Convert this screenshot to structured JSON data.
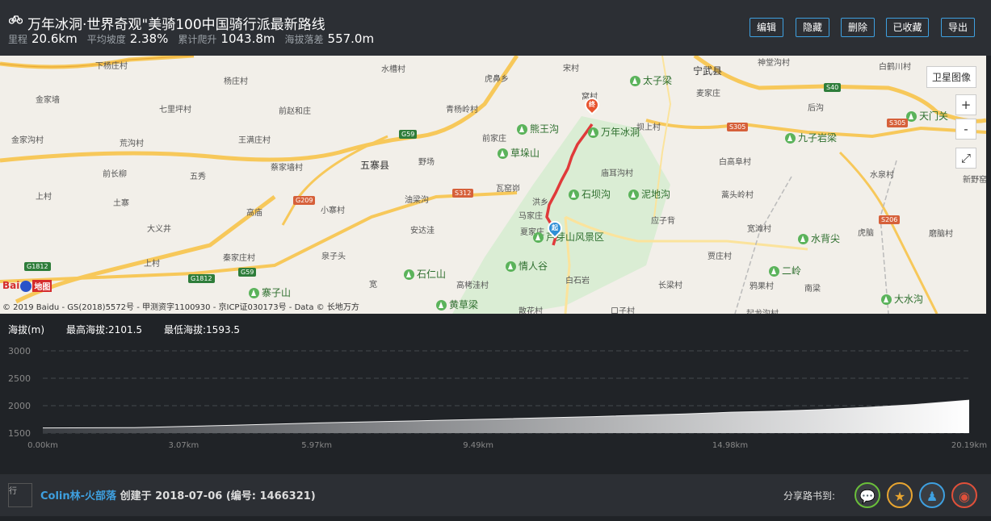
{
  "header": {
    "title": "万年冰洞·世界奇观\"美骑100中国骑行派最新路线",
    "stats": [
      {
        "label": "里程",
        "value": "20.6km"
      },
      {
        "label": "平均坡度",
        "value": "2.38%"
      },
      {
        "label": "累计爬升",
        "value": "1043.8m"
      },
      {
        "label": "海拔落差",
        "value": "557.0m"
      }
    ],
    "buttons": {
      "edit": "编辑",
      "hide": "隐藏",
      "delete": "删除",
      "collected": "已收藏",
      "export": "导出"
    }
  },
  "map": {
    "satellite_label": "卫星图像",
    "zoom_in": "+",
    "zoom_out": "-",
    "fullscreen": "⤢",
    "copyright": "© 2019 Baidu - GS(2018)5572号 - 甲测资字1100930 - 京ICP证030173号 - Data © 长地万方",
    "baidu_logo": "Bai",
    "baidu_logo_map": "地图",
    "start_label": "起",
    "end_label": "终",
    "places": [
      "下杨庄村",
      "水槽村",
      "宋村",
      "神堂沟村",
      "白鹤川村",
      "金家墙",
      "杨庄村",
      "虎鼻乡",
      "太子梁",
      "宁武县",
      "七里坪村",
      "前赵和庄",
      "青杨岭村",
      "麦家庄",
      "窝村",
      "后沟",
      "王满庄村",
      "荒沟村",
      "熊王沟",
      "万年冰洞",
      "坝上村",
      "天门关",
      "金家沟村",
      "前家庄",
      "九子岩梁",
      "五寨县",
      "蔡家墙村",
      "野场",
      "草垛山",
      "白高阜村",
      "前长柳",
      "五秀",
      "瓦窑峁",
      "庙耳沟村",
      "水泉村",
      "上村",
      "土寨",
      "油梁沟",
      "洪乡",
      "石坝沟",
      "泥地沟",
      "高庙",
      "小寨村",
      "马家庄",
      "应子背",
      "蒿头岭村",
      "新野窑",
      "大义井",
      "安达洼",
      "夏家庄",
      "芦芽山风景区",
      "宽滩村",
      "水背尖",
      "虎脑",
      "磨脑村",
      "上村",
      "秦家庄村",
      "泉子头",
      "石仁山",
      "情人谷",
      "贾庄村",
      "二岭",
      "南梁",
      "宽",
      "高栲洼村",
      "白石岩",
      "长梁村",
      "鸦果村",
      "寨子山",
      "黄草梁",
      "散花村",
      "口子村",
      "起龙沟村",
      "大水沟"
    ],
    "roads": {
      "g59a": "G59",
      "g59b": "G59",
      "g209": "G209",
      "s312": "S312",
      "g1812a": "G1812",
      "g1812b": "G1812",
      "s40": "S40",
      "s305a": "S305",
      "s305b": "S305",
      "s206": "S206"
    }
  },
  "elevation": {
    "label": "海拔(m)",
    "max_label": "最高海拔:2101.5",
    "min_label": "最低海拔:1593.5"
  },
  "chart_data": {
    "type": "area",
    "title": "",
    "ylabel": "海拔(m)",
    "xlabel": "",
    "ylim": [
      1500,
      3000
    ],
    "xlim": [
      0,
      20.19
    ],
    "yticks": [
      "3000",
      "2500",
      "2000",
      "1500"
    ],
    "xticks": [
      "0.00km",
      "3.07km",
      "5.97km",
      "9.49km",
      "14.98km",
      "20.19km"
    ],
    "xtick_values": [
      0,
      3.07,
      5.97,
      9.49,
      14.98,
      20.19
    ],
    "grid": true,
    "x": [
      0,
      2,
      4,
      6,
      8,
      10,
      12,
      14,
      15,
      16,
      17,
      18,
      19,
      20.19
    ],
    "y": [
      1593.5,
      1600,
      1640,
      1685,
      1720,
      1760,
      1800,
      1850,
      1880,
      1900,
      1930,
      1970,
      2020,
      2101.5
    ]
  },
  "footer": {
    "avatar_alt": "行",
    "author": "Colin林-火部落",
    "created_prefix": "创建于",
    "date": "2018-07-06",
    "id_text": "(编号: 1466321)",
    "share_label": "分享路书到:"
  },
  "colors": {
    "accent": "#3ea0e0",
    "route": "#e03a3a",
    "elev_fill": "#ffffff"
  }
}
